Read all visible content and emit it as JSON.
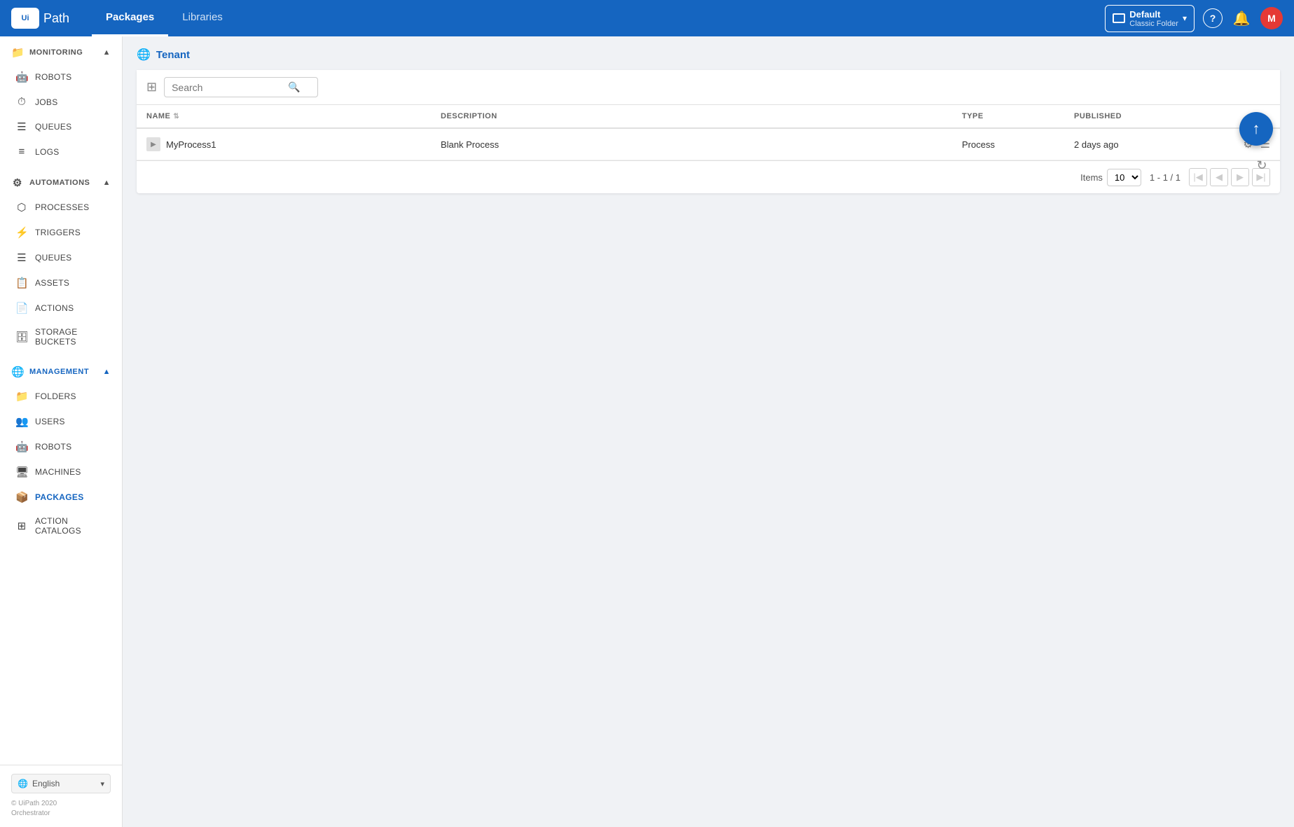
{
  "app": {
    "logo_text": "Path",
    "logo_box": "Ui"
  },
  "topnav": {
    "tabs": [
      {
        "id": "packages",
        "label": "Packages",
        "active": true
      },
      {
        "id": "libraries",
        "label": "Libraries",
        "active": false
      }
    ],
    "folder_label": "Default",
    "folder_sublabel": "Classic Folder",
    "help_icon": "?",
    "notifications_icon": "🔔",
    "avatar_letter": "M"
  },
  "sidebar": {
    "monitoring": {
      "label": "MONITORING",
      "icon": "📁",
      "expanded": true,
      "items": [
        {
          "id": "robots",
          "label": "ROBOTS",
          "icon": "🤖"
        },
        {
          "id": "jobs",
          "label": "JOBS",
          "icon": "⏱"
        },
        {
          "id": "queues",
          "label": "QUEUES",
          "icon": "☰"
        },
        {
          "id": "logs",
          "label": "LOGS",
          "icon": "≡"
        }
      ]
    },
    "automations": {
      "label": "AUTOMATIONS",
      "icon": "⚙",
      "expanded": true,
      "items": [
        {
          "id": "processes",
          "label": "PROCESSES",
          "icon": "⬡"
        },
        {
          "id": "triggers",
          "label": "TRIGGERS",
          "icon": "⚡"
        },
        {
          "id": "queues",
          "label": "QUEUES",
          "icon": "☰"
        },
        {
          "id": "assets",
          "label": "ASSETS",
          "icon": "📋"
        },
        {
          "id": "actions",
          "label": "ACTIONS",
          "icon": "📄"
        },
        {
          "id": "storage-buckets",
          "label": "STORAGE BUCKETS",
          "icon": "🗄"
        }
      ]
    },
    "management": {
      "label": "MANAGEMENT",
      "icon": "🌐",
      "expanded": true,
      "active": true,
      "items": [
        {
          "id": "folders",
          "label": "FOLDERS",
          "icon": "📁"
        },
        {
          "id": "users",
          "label": "USERS",
          "icon": "👥"
        },
        {
          "id": "robots",
          "label": "ROBOTS",
          "icon": "🤖"
        },
        {
          "id": "machines",
          "label": "MACHINES",
          "icon": "🖥"
        },
        {
          "id": "packages",
          "label": "PACKAGES",
          "icon": "📦",
          "active": true
        },
        {
          "id": "action-catalogs",
          "label": "ACTION CATALOGS",
          "icon": "⊞"
        }
      ]
    }
  },
  "footer": {
    "language": "English",
    "copyright_line1": "© UiPath 2020",
    "copyright_line2": "Orchestrator"
  },
  "breadcrumb": {
    "icon": "🌐",
    "label": "Tenant"
  },
  "toolbar": {
    "search_placeholder": "Search"
  },
  "table": {
    "columns": [
      {
        "id": "name",
        "label": "NAME",
        "sortable": true
      },
      {
        "id": "description",
        "label": "DESCRIPTION",
        "sortable": false
      },
      {
        "id": "type",
        "label": "TYPE",
        "sortable": false
      },
      {
        "id": "published",
        "label": "PUBLISHED",
        "sortable": false
      }
    ],
    "rows": [
      {
        "name": "MyProcess1",
        "description": "Blank Process",
        "type": "Process",
        "published": "2 days ago"
      }
    ]
  },
  "pagination": {
    "items_label": "Items",
    "items_per_page": "10",
    "page_info": "1 - 1 / 1"
  },
  "fab": {
    "icon": "↑",
    "title": "Upload Package"
  },
  "colors": {
    "primary": "#1565c0",
    "active_text": "#1565c0"
  }
}
